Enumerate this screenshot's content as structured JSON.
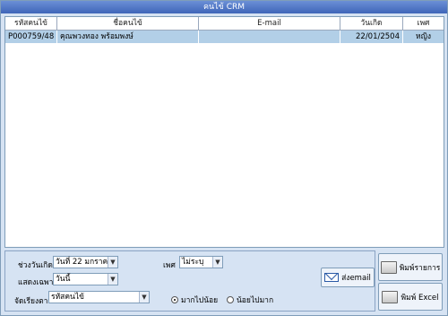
{
  "window": {
    "title": "คนไข้ CRM"
  },
  "table": {
    "headers": [
      "รหัสคนไข้",
      "ชื่อคนไข้",
      "E-mail",
      "วันเกิด",
      "เพศ"
    ],
    "rows": [
      [
        "P000759/48",
        "คุณพวงทอง พร้อมพงษ์",
        "",
        "22/01/2504",
        "หญิง"
      ]
    ]
  },
  "filters": {
    "birth_range_label": "ช่วงวันเกิด",
    "birth_range_value": "วันที่ 22  มกราคม",
    "display_label": "แสดงเฉพาะ",
    "display_value": "วันนี้",
    "sex_label": "เพศ",
    "sex_value": "ไม่ระบุ",
    "sort_label": "จัดเรียงตาม",
    "sort_value": "รหัสคนไข้",
    "order_desc": "มากไปน้อย",
    "order_asc": "น้อยไปมาก"
  },
  "buttons": {
    "send_email": "ส่งemail",
    "print_list": "พิมพ์รายการ",
    "print_excel": "พิมพ์ Excel"
  }
}
